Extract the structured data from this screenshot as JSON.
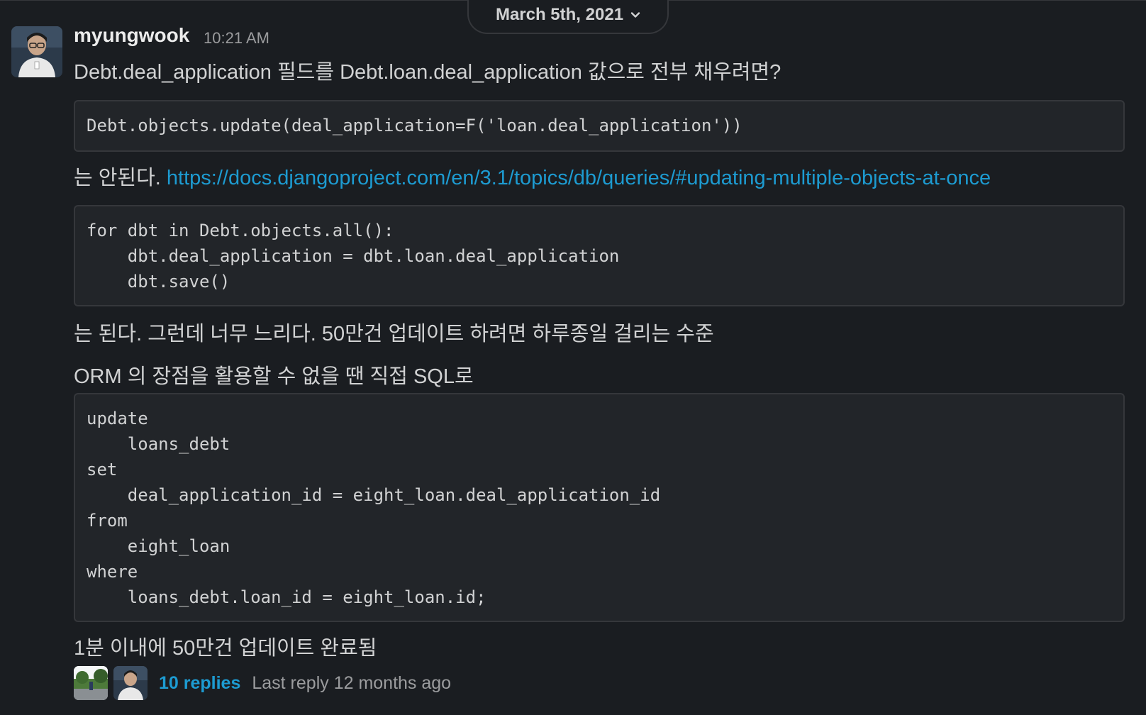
{
  "date_divider": {
    "label": "March 5th, 2021",
    "icon": "chevron-down-icon"
  },
  "message": {
    "author": "myungwook",
    "time": "10:21 AM",
    "avatar_icon": "user-avatar",
    "line1": "Debt.deal_application 필드를 Debt.loan.deal_application 값으로 전부 채우려면?",
    "code1": [
      "Debt.objects.update(deal_application=F('loan.deal_application'))"
    ],
    "line2_prefix": "는 안된다. ",
    "line2_link": "https://docs.djangoproject.com/en/3.1/topics/db/queries/#updating-multiple-objects-at-once",
    "code2": [
      "for dbt in Debt.objects.all():",
      "    dbt.deal_application = dbt.loan.deal_application",
      "    dbt.save()"
    ],
    "line3": "는 된다. 그런데 너무 느리다. 50만건 업데이트 하려면 하루종일 걸리는 수준",
    "line4": "ORM 의 장점을 활용할 수 없을 땐 직접 SQL로",
    "code3": [
      "update",
      "    loans_debt",
      "set",
      "    deal_application_id = eight_loan.deal_application_id",
      "from",
      "    eight_loan",
      "where",
      "    loans_debt.loan_id = eight_loan.id;"
    ],
    "line5": "1분 이내에 50만건 업데이트 완료됨"
  },
  "thread": {
    "replies": "10 replies",
    "last_reply": "Last reply 12 months ago"
  },
  "colors": {
    "background": "#1a1d21",
    "link": "#1d9bd1",
    "code_bg": "#222529",
    "border": "#35373b"
  }
}
